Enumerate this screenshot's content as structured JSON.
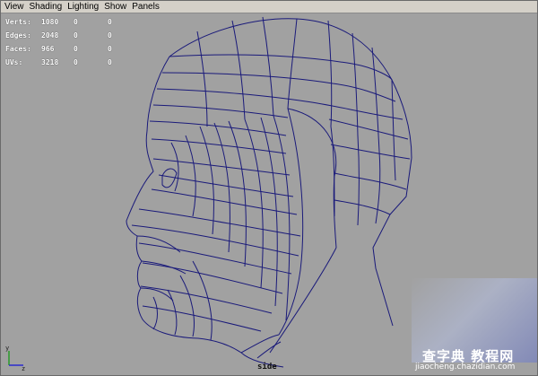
{
  "menubar": {
    "items": [
      "View",
      "Shading",
      "Lighting",
      "Show",
      "Panels"
    ]
  },
  "hud": {
    "verts": {
      "label": "Verts:",
      "value": "1080",
      "a": "0",
      "b": "0"
    },
    "edges": {
      "label": "Edges:",
      "value": "2048",
      "a": "0",
      "b": "0"
    },
    "faces": {
      "label": "Faces:",
      "value": "966",
      "a": "0",
      "b": "0"
    },
    "uvs": {
      "label": "UVs:",
      "value": "3218",
      "a": "0",
      "b": "0"
    }
  },
  "camera_label": "side",
  "axis": {
    "y": "y",
    "z": "z"
  },
  "watermark": {
    "title": "查字典 教程网",
    "url": "jiaocheng.chazidian.com"
  },
  "colors": {
    "wire": "#1a1a7a",
    "background": "#a1a1a1",
    "hud_text": "#ffffff"
  }
}
